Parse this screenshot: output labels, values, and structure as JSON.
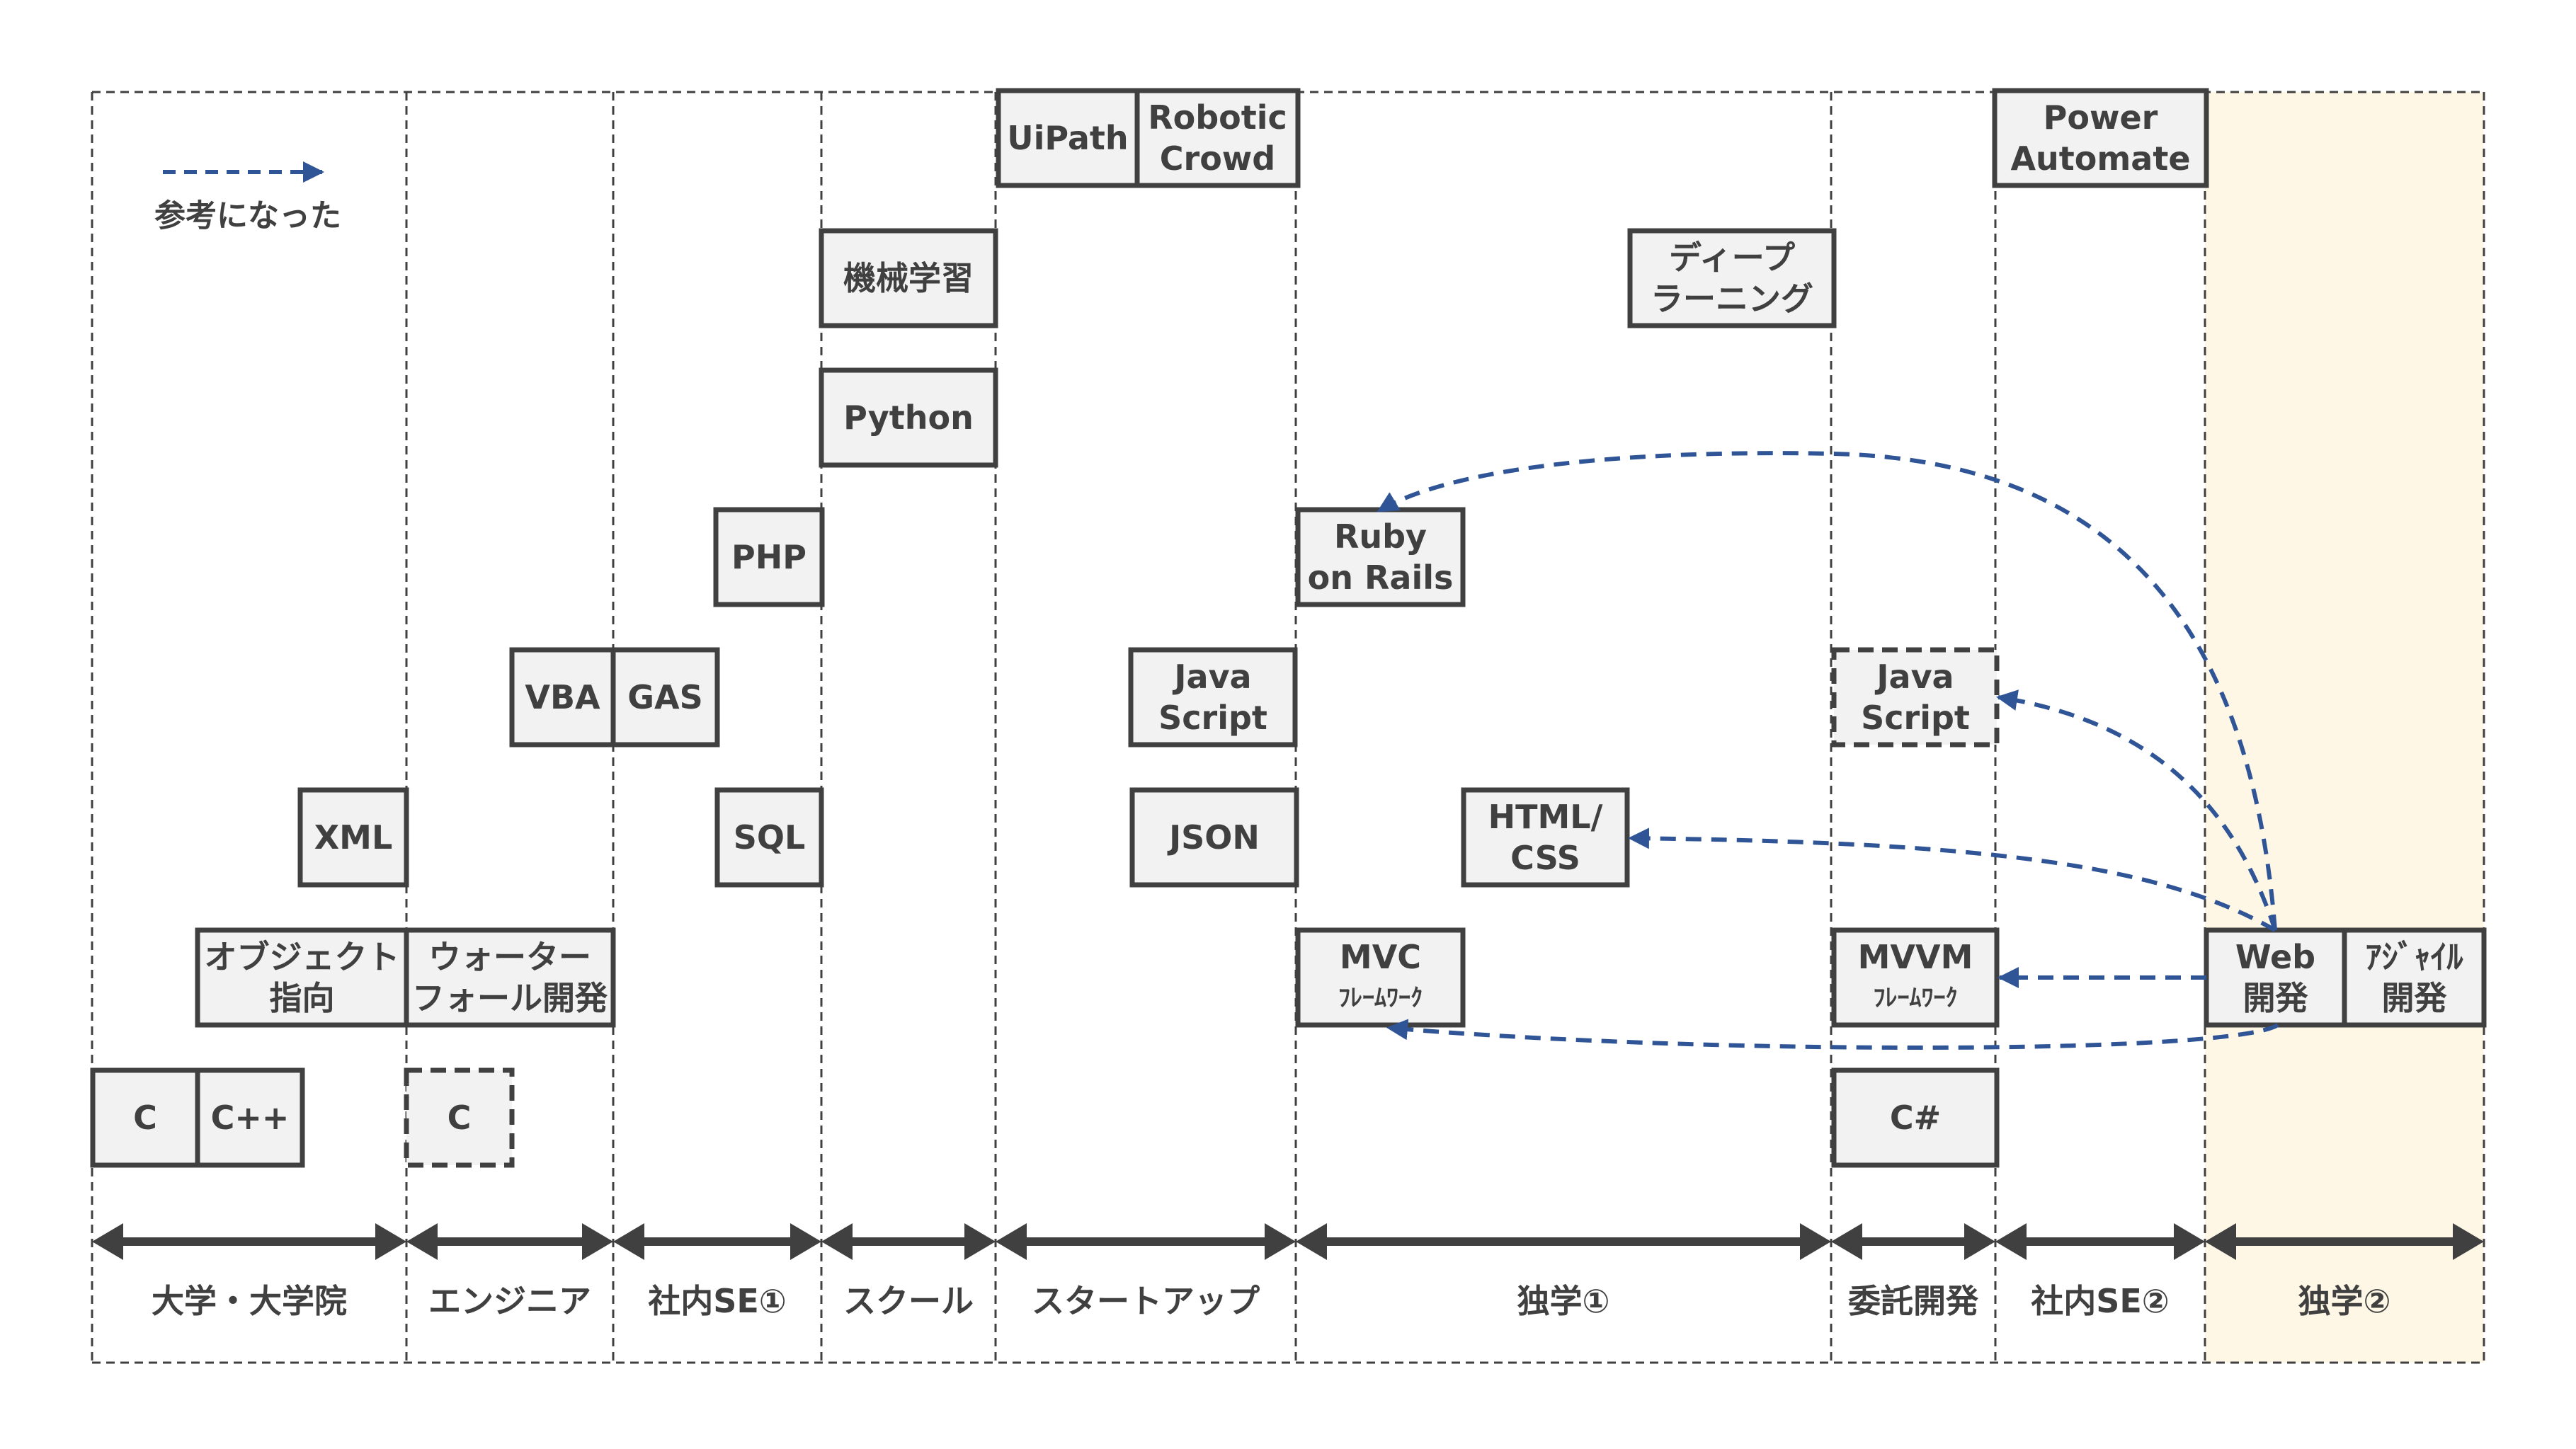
{
  "colors": {
    "box_fill": "#f2f2f2",
    "box_border": "#404040",
    "text": "#404040",
    "reference_arrow": "#2f5597",
    "highlight_period": "#fff7e5"
  },
  "legend": {
    "icon": "dashed-arrow-icon",
    "label": "参考になった"
  },
  "periods": [
    {
      "id": "university",
      "label": "大学・大学院",
      "highlighted": false
    },
    {
      "id": "engineer",
      "label": "エンジニア",
      "highlighted": false
    },
    {
      "id": "in-house-se-1",
      "label": "社内SE①",
      "highlighted": false
    },
    {
      "id": "school",
      "label": "スクール",
      "highlighted": false
    },
    {
      "id": "startup",
      "label": "スタートアップ",
      "highlighted": false
    },
    {
      "id": "self-study-1",
      "label": "独学①",
      "highlighted": false
    },
    {
      "id": "contract-dev",
      "label": "委託開発",
      "highlighted": false
    },
    {
      "id": "in-house-se-2",
      "label": "社内SE②",
      "highlighted": false
    },
    {
      "id": "self-study-2",
      "label": "独学②",
      "highlighted": true
    }
  ],
  "skills": [
    {
      "id": "c-univ",
      "lines": [
        "C"
      ],
      "period": "university",
      "style": "solid"
    },
    {
      "id": "cpp",
      "lines": [
        "C++"
      ],
      "period": "university",
      "style": "solid"
    },
    {
      "id": "oop",
      "lines": [
        "オブジェクト",
        "指向"
      ],
      "period": "university",
      "style": "solid"
    },
    {
      "id": "xml",
      "lines": [
        "XML"
      ],
      "period": "university",
      "style": "solid"
    },
    {
      "id": "c-eng",
      "lines": [
        "C"
      ],
      "period": "engineer",
      "style": "dashed"
    },
    {
      "id": "waterfall",
      "lines": [
        "ウォーター",
        "フォール開発"
      ],
      "period": "engineer",
      "style": "solid"
    },
    {
      "id": "vba",
      "lines": [
        "VBA"
      ],
      "period": "engineer",
      "style": "solid"
    },
    {
      "id": "gas",
      "lines": [
        "GAS"
      ],
      "period": "in-house-se-1",
      "style": "solid"
    },
    {
      "id": "sql",
      "lines": [
        "SQL"
      ],
      "period": "in-house-se-1",
      "style": "solid"
    },
    {
      "id": "php",
      "lines": [
        "PHP"
      ],
      "period": "in-house-se-1",
      "style": "solid"
    },
    {
      "id": "ml",
      "lines": [
        "機械学習"
      ],
      "period": "school",
      "style": "solid"
    },
    {
      "id": "python",
      "lines": [
        "Python"
      ],
      "period": "school",
      "style": "solid"
    },
    {
      "id": "uipath",
      "lines": [
        "UiPath"
      ],
      "period": "startup",
      "style": "solid"
    },
    {
      "id": "robotic-crowd",
      "lines": [
        "Robotic",
        "Crowd"
      ],
      "period": "startup",
      "style": "solid"
    },
    {
      "id": "js-startup",
      "lines": [
        "Java",
        "Script"
      ],
      "period": "startup",
      "style": "solid"
    },
    {
      "id": "json",
      "lines": [
        "JSON"
      ],
      "period": "startup",
      "style": "solid"
    },
    {
      "id": "rails",
      "lines": [
        "Ruby",
        "on Rails"
      ],
      "period": "self-study-1",
      "style": "solid"
    },
    {
      "id": "mvc",
      "lines": [
        "MVC",
        "ﾌﾚｰﾑﾜｰｸ"
      ],
      "period": "self-study-1",
      "style": "solid"
    },
    {
      "id": "html-css",
      "lines": [
        "HTML/",
        "CSS"
      ],
      "period": "self-study-1",
      "style": "solid"
    },
    {
      "id": "deep-learning",
      "lines": [
        "ディープ",
        "ラーニング"
      ],
      "period": "self-study-1",
      "style": "solid"
    },
    {
      "id": "js-contract",
      "lines": [
        "Java",
        "Script"
      ],
      "period": "contract-dev",
      "style": "dashed"
    },
    {
      "id": "mvvm",
      "lines": [
        "MVVM",
        "ﾌﾚｰﾑﾜｰｸ"
      ],
      "period": "contract-dev",
      "style": "solid"
    },
    {
      "id": "csharp",
      "lines": [
        "C#"
      ],
      "period": "contract-dev",
      "style": "solid"
    },
    {
      "id": "power-automate",
      "lines": [
        "Power",
        "Automate"
      ],
      "period": "in-house-se-2",
      "style": "solid"
    },
    {
      "id": "web-dev",
      "lines": [
        "Web",
        "開発"
      ],
      "period": "self-study-2",
      "style": "solid"
    },
    {
      "id": "agile",
      "lines": [
        "ｱｼﾞｬｲﾙ",
        "開発"
      ],
      "period": "self-study-2",
      "style": "solid"
    }
  ],
  "references": [
    {
      "from": "web-dev",
      "to": "rails"
    },
    {
      "from": "web-dev",
      "to": "js-contract"
    },
    {
      "from": "web-dev",
      "to": "html-css"
    },
    {
      "from": "web-dev",
      "to": "mvvm"
    },
    {
      "from": "web-dev",
      "to": "mvc"
    }
  ]
}
